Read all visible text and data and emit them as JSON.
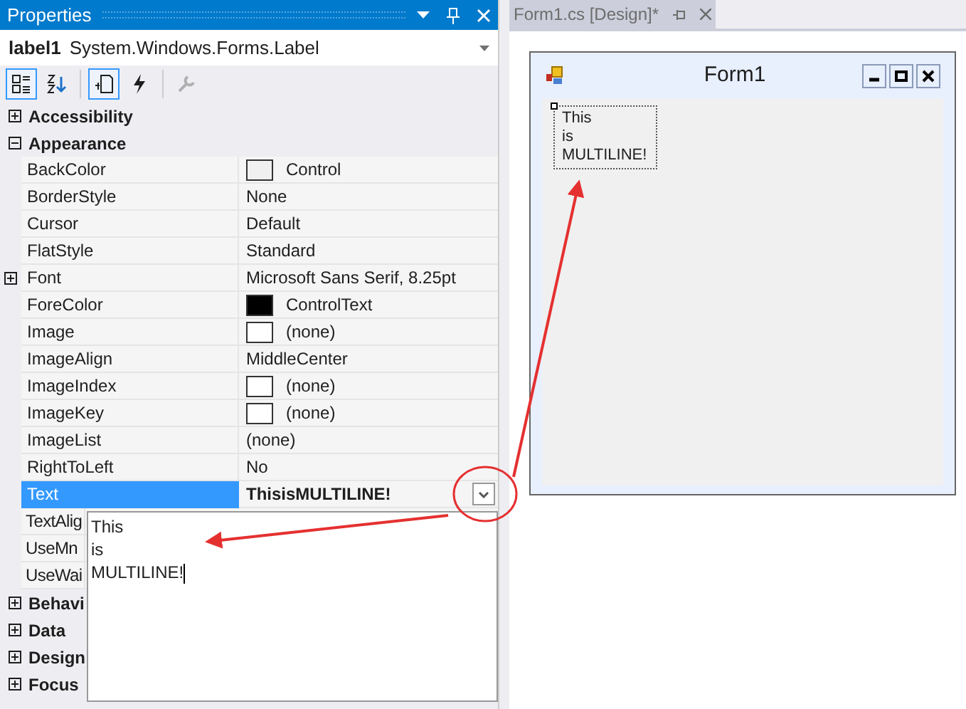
{
  "properties_panel": {
    "title": "Properties",
    "object": {
      "name": "label1",
      "type": "System.Windows.Forms.Label"
    },
    "toolbar": [
      {
        "kind": "categorized",
        "selected": true
      },
      {
        "kind": "alphabetical",
        "selected": false
      },
      {
        "kind": "properties",
        "selected": true
      },
      {
        "kind": "events",
        "selected": false
      },
      {
        "kind": "pages",
        "selected": false
      }
    ],
    "rows": [
      {
        "kind": "category",
        "name": "Accessibility",
        "expanded": false
      },
      {
        "kind": "category",
        "name": "Appearance",
        "expanded": true
      },
      {
        "kind": "property",
        "name": "BackColor",
        "value": "Control",
        "color": "#f0f0f0"
      },
      {
        "kind": "property",
        "name": "BorderStyle",
        "value": "None"
      },
      {
        "kind": "property",
        "name": "Cursor",
        "value": "Default"
      },
      {
        "kind": "property",
        "name": "FlatStyle",
        "value": "Standard"
      },
      {
        "kind": "property",
        "name": "Font",
        "value": "Microsoft Sans Serif, 8.25pt",
        "expanded": false
      },
      {
        "kind": "property",
        "name": "ForeColor",
        "value": "ControlText",
        "color": "#000000"
      },
      {
        "kind": "property",
        "name": "Image",
        "value": "(none)",
        "color": "#ffffff"
      },
      {
        "kind": "property",
        "name": "ImageAlign",
        "value": "MiddleCenter"
      },
      {
        "kind": "property",
        "name": "ImageIndex",
        "value": "(none)",
        "color": "#ffffff"
      },
      {
        "kind": "property",
        "name": "ImageKey",
        "value": "(none)",
        "color": "#ffffff"
      },
      {
        "kind": "property",
        "name": "ImageList",
        "value": "(none)"
      },
      {
        "kind": "property",
        "name": "RightToLeft",
        "value": "No"
      },
      {
        "kind": "property",
        "name": "Text",
        "value": "ThisisMULTILINE!",
        "selected": true,
        "edited": true
      },
      {
        "kind": "property",
        "name": "TextAlig"
      },
      {
        "kind": "property",
        "name": "UseMn"
      },
      {
        "kind": "property",
        "name": "UseWai"
      },
      {
        "kind": "category",
        "name": "Behavi",
        "expanded": false
      },
      {
        "kind": "category",
        "name": "Data",
        "expanded": false
      },
      {
        "kind": "category",
        "name": "Design",
        "expanded": false
      },
      {
        "kind": "category",
        "name": "Focus",
        "expanded": false
      }
    ],
    "text_editor": {
      "value": "This\nis\nMULTILINE!"
    }
  },
  "designer": {
    "tab": {
      "label": "Form1.cs [Design]*",
      "selected": true
    },
    "form": {
      "title": "Form1",
      "label": "This\nis\nMULTILINE!"
    }
  }
}
